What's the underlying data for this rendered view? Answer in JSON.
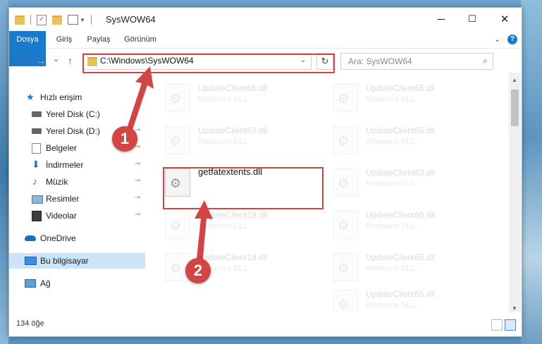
{
  "window": {
    "title": "SysWOW64",
    "controls": {
      "minimize": "─",
      "maximize": "☐",
      "close": "✕"
    }
  },
  "ribbon": {
    "tabs": [
      "Dosya",
      "Giriş",
      "Paylaş",
      "Görünüm"
    ],
    "expand_icon": "chevron-down-icon",
    "help": "?"
  },
  "nav": {
    "back": "←",
    "forward": "→",
    "recent": "⌄",
    "up": "↑",
    "address": "C:\\Windows\\SysWOW64",
    "refresh": "↻",
    "search_placeholder": "Ara: SysWOW64",
    "search_icon": "⌕"
  },
  "sidebar": {
    "items": [
      {
        "label": "Hızlı erişim",
        "icon": "star-icon",
        "pinned": false
      },
      {
        "label": "Yerel Disk (C:)",
        "icon": "drive-icon",
        "pinned": false
      },
      {
        "label": "Yerel Disk (D:)",
        "icon": "drive-icon",
        "pinned": true
      },
      {
        "label": "Belgeler",
        "icon": "documents-icon",
        "pinned": true
      },
      {
        "label": "İndirmeler",
        "icon": "download-icon",
        "pinned": true
      },
      {
        "label": "Müzik",
        "icon": "music-icon",
        "pinned": true
      },
      {
        "label": "Resimler",
        "icon": "pictures-icon",
        "pinned": true
      },
      {
        "label": "Videolar",
        "icon": "videos-icon",
        "pinned": true
      },
      {
        "label": "OneDrive",
        "icon": "cloud-icon",
        "pinned": false
      },
      {
        "label": "Bu bilgisayar",
        "icon": "computer-icon",
        "pinned": false
      },
      {
        "label": "Ağ",
        "icon": "network-icon",
        "pinned": false
      }
    ],
    "pin_glyph": "📌"
  },
  "files": [
    {
      "name": "UpdateClient65.dll",
      "type": "Resource DLL"
    },
    {
      "name": "UpdateClient65.dll",
      "type": "Resource DLL"
    },
    {
      "name": "UpdateClient63.dll",
      "type": "Resource DLL"
    },
    {
      "name": "UpdateClient65.dll",
      "type": "Resource DLL"
    },
    {
      "name": "getfatextents.dll",
      "type": ""
    },
    {
      "name": "UpdateClient63.dll",
      "type": "Resource DLL"
    },
    {
      "name": "UpdateClient19.dll",
      "type": "Resource DLL"
    },
    {
      "name": "UpdateClient65.dll",
      "type": "Resource DLL"
    },
    {
      "name": "UpdateClient19.dll",
      "type": "Resource DLL"
    },
    {
      "name": "UpdateClient65.dll",
      "type": "Resource DLL"
    },
    {
      "name": "UpdateClient65.dll",
      "type": "Resource DLL"
    }
  ],
  "status": {
    "count": "134 öğe"
  },
  "annotations": {
    "step1": "1",
    "step2": "2",
    "color": "#d24545"
  }
}
